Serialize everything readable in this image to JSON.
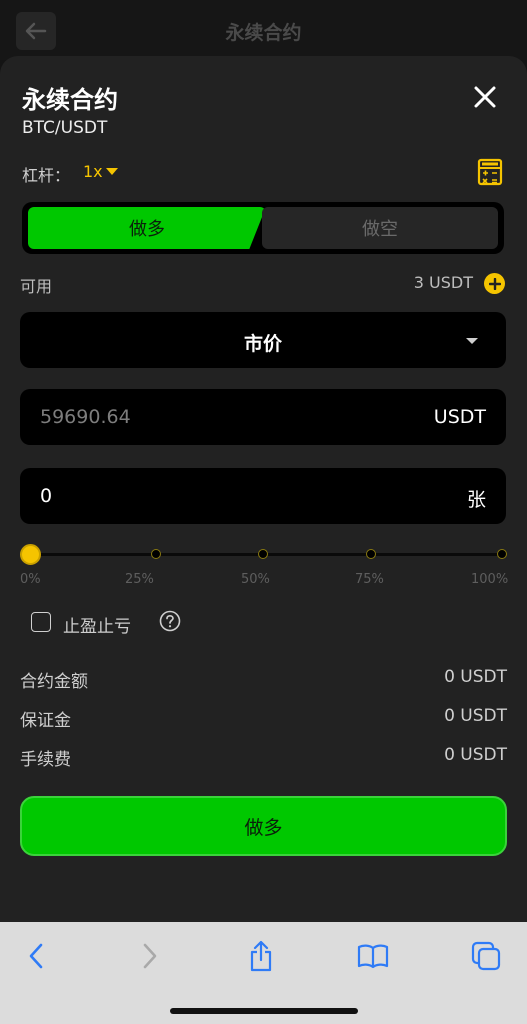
{
  "background": {
    "title": "永续合约"
  },
  "sheet": {
    "title": "永续合约",
    "pair": "BTC/USDT",
    "leverage_label": "杠杆：",
    "leverage_value": "1x"
  },
  "toggle": {
    "long_label": "做多",
    "short_label": "做空",
    "selected": "long"
  },
  "available": {
    "label": "可用",
    "value": "3 USDT"
  },
  "order_type": {
    "selected": "市价"
  },
  "price": {
    "value": "59690.64",
    "unit": "USDT"
  },
  "quantity": {
    "value": "0",
    "unit": "张"
  },
  "slider": {
    "value_percent": 0,
    "marks": [
      "0%",
      "25%",
      "50%",
      "75%",
      "100%"
    ]
  },
  "tp_sl": {
    "label": "止盈止亏",
    "checked": false
  },
  "info": [
    {
      "label": "合约金额",
      "value": "0 USDT"
    },
    {
      "label": "保证金",
      "value": "0 USDT"
    },
    {
      "label": "手续费",
      "value": "0 USDT"
    }
  ],
  "submit": {
    "label": "做多"
  },
  "colors": {
    "accent_yellow": "#f5c400",
    "long_green": "#00c800",
    "sheet_bg": "#222222",
    "field_bg": "#000000"
  },
  "icons": [
    "back-arrow-icon",
    "close-icon",
    "caret-down-icon",
    "calculator-icon",
    "plus-icon",
    "help-icon",
    "safari-back-icon",
    "safari-forward-icon",
    "share-icon",
    "bookmarks-icon",
    "tabs-icon"
  ]
}
